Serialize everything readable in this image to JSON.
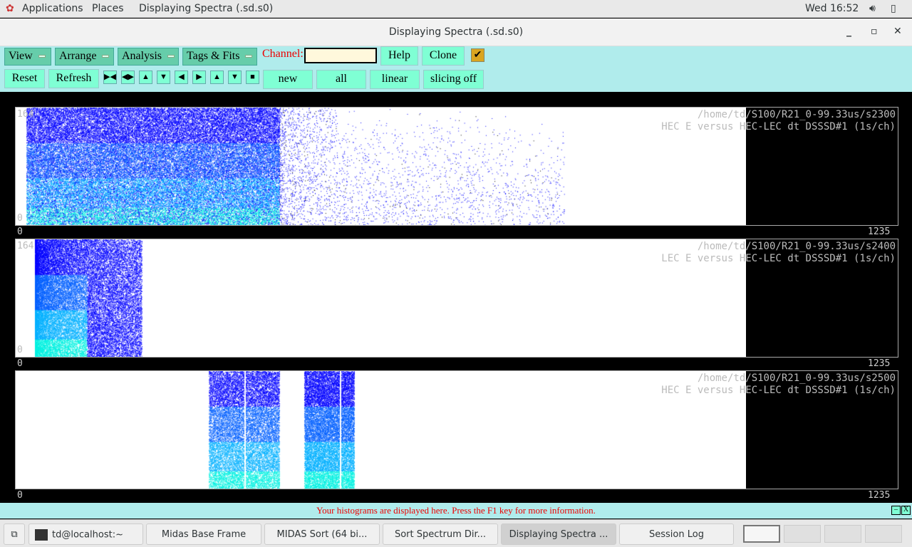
{
  "topbar": {
    "applications": "Applications",
    "places": "Places",
    "window": "Displaying Spectra (.sd.s0)",
    "clock": "Wed 16:52"
  },
  "window": {
    "title": "Displaying Spectra (.sd.s0)",
    "minimize": "_",
    "maximize": "▫",
    "close": "✕"
  },
  "toolbar": {
    "menus": [
      "View",
      "Arrange",
      "Analysis",
      "Tags & Fits"
    ],
    "channel_label": "Channel:",
    "channel_value": "",
    "help": "Help",
    "clone": "Clone",
    "checkbox_checked": true,
    "reset": "Reset",
    "refresh": "Refresh",
    "new": "new",
    "all": "all",
    "linear": "linear",
    "slicing": "slicing off"
  },
  "spectra": [
    {
      "path": "/home/td/S100/R21_0-99.33us/s2300",
      "title": "HEC E versus HEC-LEC dt DSSSD#1 (1s/ch)",
      "ymax": "164",
      "ymin": "0",
      "xmin": "0",
      "xmax": "1235"
    },
    {
      "path": "/home/td/S100/R21_0-99.33us/s2400",
      "title": "LEC E versus HEC-LEC dt DSSSD#1 (1s/ch)",
      "ymax": "164",
      "ymin": "0",
      "xmin": "0",
      "xmax": "1235"
    },
    {
      "path": "/home/td/S100/R21_0-99.33us/s2500",
      "title": "HEC E versus HEC-LEC dt DSSSD#1 (1s/ch)",
      "ymax": "",
      "ymin": "",
      "xmin": "0",
      "xmax": "1235"
    }
  ],
  "status": "Your histograms are displayed here. Press the F1 key for more information.",
  "taskbar": {
    "items": [
      "td@localhost:~",
      "Midas Base Frame",
      "MIDAS Sort (64 bi...",
      "Sort Spectrum Dir...",
      "Displaying Spectra ...",
      "Session Log"
    ]
  },
  "colors": {
    "toolbar": "#b0ecec",
    "button": "#7fffd4",
    "menu": "#66cdaa",
    "status_text": "#ee0000"
  }
}
